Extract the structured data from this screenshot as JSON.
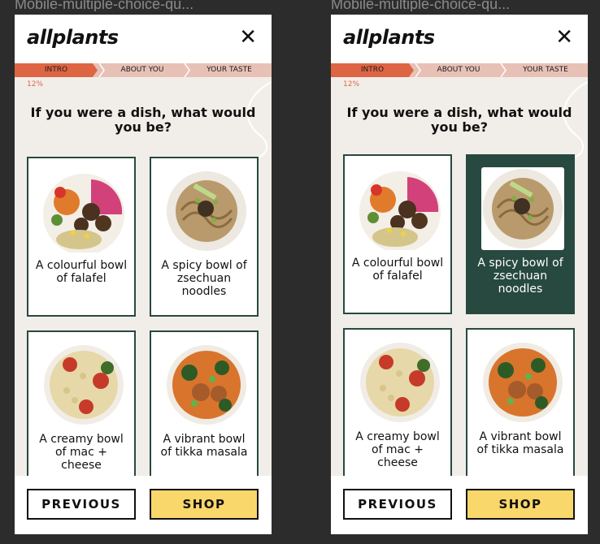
{
  "frames": [
    {
      "title": "Mobile-multiple-choice-qu..."
    },
    {
      "title": "Mobile-multiple-choice-qu..."
    }
  ],
  "app": {
    "logo": "allplants",
    "close_glyph": "✕"
  },
  "progress": {
    "steps": [
      "INTRO",
      "ABOUT YOU",
      "YOUR TASTE"
    ],
    "percent_label": "12%",
    "percent": 12
  },
  "question": "If you were a dish, what would you be?",
  "options": [
    {
      "label": "A colourful bowl of falafel",
      "icon": "falafel-bowl-photo"
    },
    {
      "label": "A spicy bowl of zsechuan noodles",
      "icon": "noodle-bowl-photo"
    },
    {
      "label": "A creamy bowl of mac + cheese",
      "icon": "mac-cheese-photo"
    },
    {
      "label": "A vibrant bowl of tikka masala",
      "icon": "tikka-masala-photo"
    }
  ],
  "selected_option_state_b": 1,
  "buttons": {
    "previous": "PREVIOUS",
    "shop": "SHOP"
  },
  "colors": {
    "accent_dark_green": "#27493f",
    "progress_active": "#de6543",
    "progress_track": "#e8c1b6",
    "shop_yellow": "#f9d76b",
    "background": "#f1eee9"
  }
}
